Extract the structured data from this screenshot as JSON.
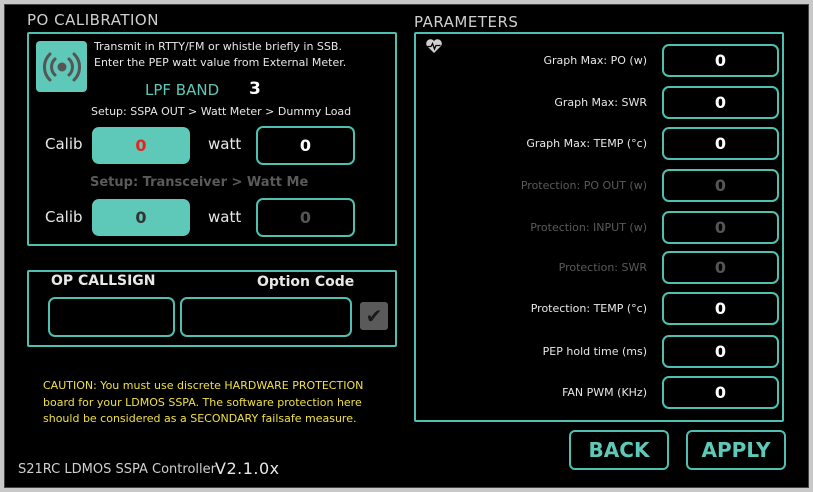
{
  "calibration": {
    "title": "PO CALIBRATION",
    "instruction_line1": "Transmit in RTTY/FM or whistle briefly in SSB.",
    "instruction_line2": "Enter the PEP watt value from External Meter.",
    "lpf_band_label": "LPF BAND",
    "lpf_band_value": "3",
    "setup1": "Setup: SSPA OUT > Watt Meter > Dummy Load",
    "calib_label": "Calib",
    "watt_label": "watt",
    "calib1_value": "0",
    "watt1_value": "0",
    "setup2": "Setup: Transceiver > Watt Me",
    "calib2_value": "0",
    "watt2_value": "0"
  },
  "callsign": {
    "op_callsign_label": "OP CALLSIGN",
    "option_code_label": "Option Code",
    "op_callsign_value": "",
    "option_code_value": "",
    "check_glyph": "✔"
  },
  "caution": {
    "line1": "CAUTION: You must use discrete HARDWARE PROTECTION",
    "line2": "board for your LDMOS SSPA. The software protection here",
    "line3": "should be considered as a SECONDARY failsafe measure."
  },
  "parameters": {
    "title": "PARAMETERS",
    "rows": [
      {
        "label": "Graph Max: PO (w)",
        "value": "0",
        "enabled": true
      },
      {
        "label": "Graph Max: SWR",
        "value": "0",
        "enabled": true
      },
      {
        "label": "Graph Max: TEMP (°c)",
        "value": "0",
        "enabled": true
      },
      {
        "label": "Protection: PO OUT (w)",
        "value": "0",
        "enabled": false
      },
      {
        "label": "Protection: INPUT  (w)",
        "value": "0",
        "enabled": false
      },
      {
        "label": "Protection: SWR",
        "value": "0",
        "enabled": false
      },
      {
        "label": "Protection: TEMP (°c)",
        "value": "0",
        "enabled": true
      },
      {
        "label": "PEP hold time (ms)",
        "value": "0",
        "enabled": true
      },
      {
        "label": "FAN PWM (KHz)",
        "value": "0",
        "enabled": true
      }
    ]
  },
  "buttons": {
    "back": "BACK",
    "apply": "APPLY"
  },
  "footer": {
    "app_name": "S21RC LDMOS SSPA Controller",
    "version": "V2.1.0x"
  },
  "colors": {
    "accent": "#4fbfb0",
    "calib_highlight": "#e8231e",
    "caution": "#f0e040"
  },
  "icons": {
    "broadcast": "broadcast-icon",
    "heartbeat": "heartbeat-icon",
    "check": "check-icon"
  }
}
